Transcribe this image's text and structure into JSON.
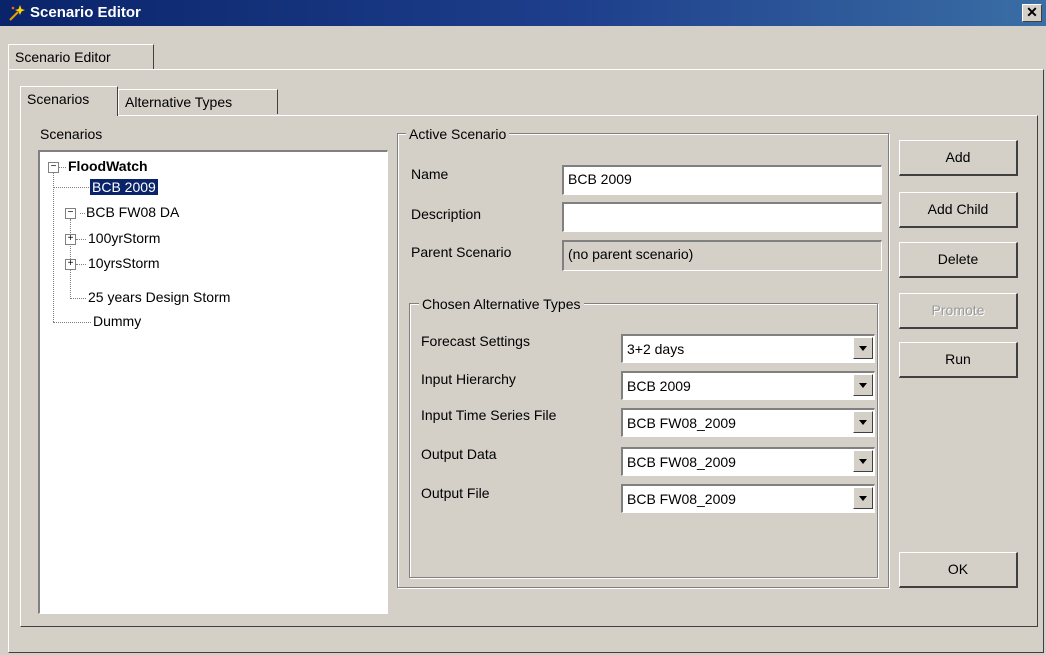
{
  "window": {
    "title": "Scenario Editor",
    "close_glyph": "✕"
  },
  "tabs": {
    "outer": [
      "Scenario Editor"
    ],
    "inner": [
      "Scenarios",
      "Alternative Types"
    ]
  },
  "scenarios_panel": {
    "label": "Scenarios",
    "tree": {
      "root": "FloodWatch",
      "items": [
        "BCB 2009",
        "BCB FW08 DA",
        "100yrStorm",
        "10yrsStorm",
        "25 years Design Storm",
        "Dummy"
      ],
      "selected": "BCB 2009",
      "expander_minus": "−",
      "expander_plus": "+"
    }
  },
  "active_scenario": {
    "legend": "Active Scenario",
    "name_label": "Name",
    "name_value": "BCB 2009",
    "description_label": "Description",
    "description_value": "",
    "parent_label": "Parent Scenario",
    "parent_value": "(no parent scenario)"
  },
  "chosen_alternative_types": {
    "legend": "Chosen Alternative Types",
    "rows": [
      {
        "label": "Forecast Settings",
        "value": "3+2 days"
      },
      {
        "label": "Input Hierarchy",
        "value": "BCB 2009"
      },
      {
        "label": "Input Time Series File",
        "value": "BCB FW08_2009"
      },
      {
        "label": "Output Data",
        "value": "BCB FW08_2009"
      },
      {
        "label": "Output File",
        "value": "BCB FW08_2009"
      }
    ]
  },
  "buttons": {
    "add": "Add",
    "add_child": "Add Child",
    "delete": "Delete",
    "promote": "Promote",
    "run": "Run",
    "ok": "OK"
  }
}
